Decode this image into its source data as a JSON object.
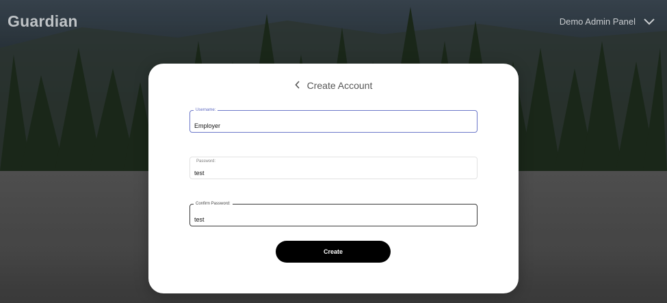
{
  "app": {
    "logo_text": "Guardian"
  },
  "header": {
    "admin_menu_label": "Demo Admin Panel",
    "admin_menu_icon": "chevron-down-icon"
  },
  "form": {
    "title": "Create Account",
    "back_icon": "chevron-left-icon",
    "fields": {
      "username": {
        "label": "Username:",
        "value": "Employer"
      },
      "password": {
        "label": "Password:",
        "value": "test"
      },
      "confirm_password": {
        "label": "Confirm Password:",
        "value": "test"
      }
    },
    "submit_label": "Create"
  },
  "colors": {
    "accent_focus": "#6b77c9",
    "button_bg": "#000000",
    "card_bg": "#ffffff"
  }
}
